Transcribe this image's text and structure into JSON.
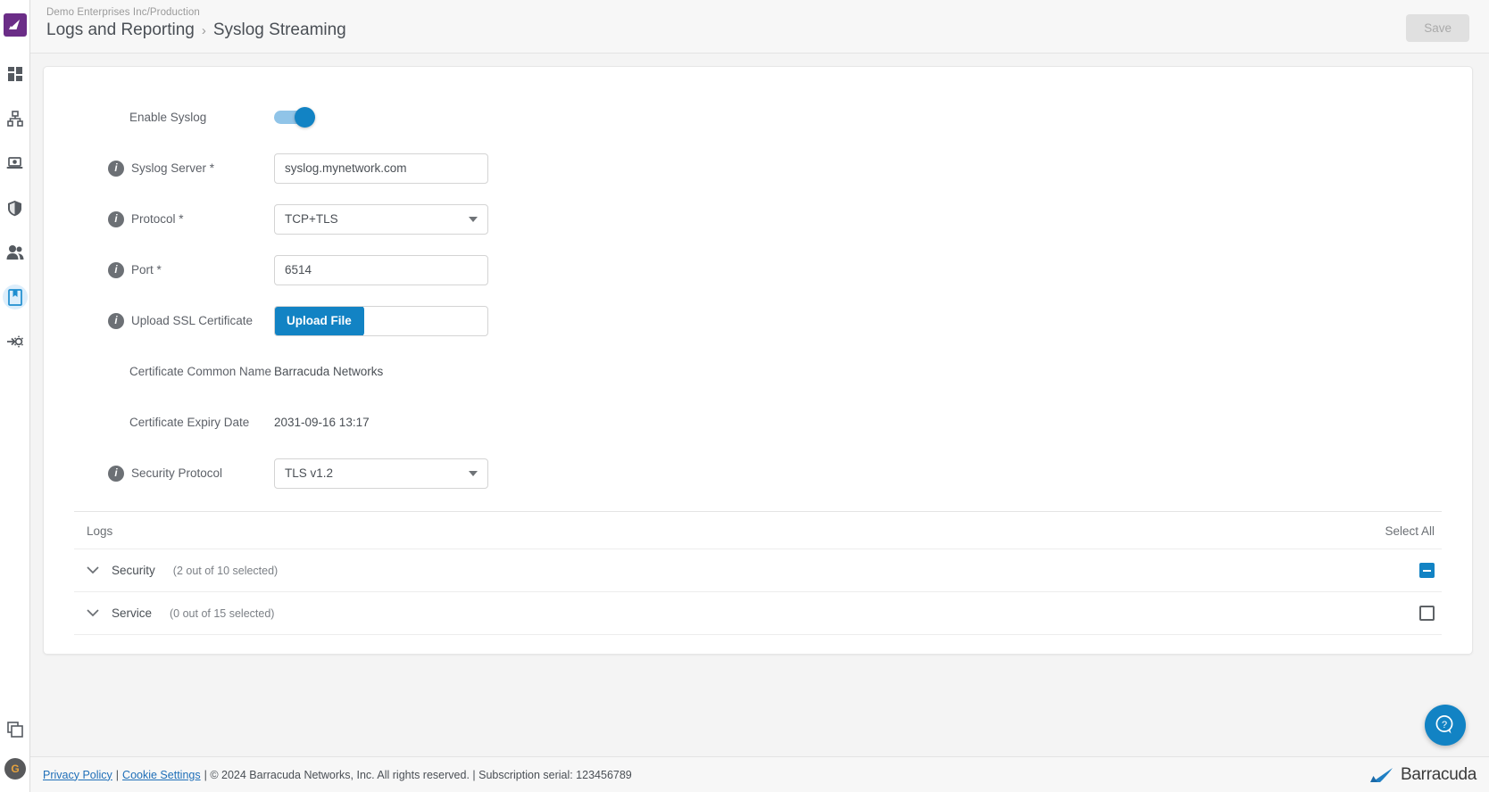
{
  "sidebar": {
    "logo_icon": "barracuda-fin-logo",
    "items": [
      {
        "icon": "dashboard-grid-icon",
        "name": "dashboard",
        "active": false
      },
      {
        "icon": "network-sitemap-icon",
        "name": "network",
        "active": false
      },
      {
        "icon": "endpoint-laptop-icon",
        "name": "endpoints",
        "active": false
      },
      {
        "icon": "shield-icon",
        "name": "security",
        "active": false
      },
      {
        "icon": "users-icon",
        "name": "users",
        "active": false
      },
      {
        "icon": "book-logs-icon",
        "name": "logs-and-reporting",
        "active": true
      },
      {
        "icon": "settings-gear-arrow-icon",
        "name": "advanced-settings",
        "active": false
      }
    ],
    "bottom": {
      "copy_icon": "copy-layers-icon",
      "avatar_initial": "G"
    }
  },
  "header": {
    "tenant": "Demo Enterprises Inc/Production",
    "breadcrumb_parent": "Logs and Reporting",
    "breadcrumb_separator": "›",
    "breadcrumb_current": "Syslog Streaming",
    "save_label": "Save",
    "save_disabled": true
  },
  "form": {
    "enable_syslog": {
      "label": "Enable Syslog",
      "value": true
    },
    "syslog_server": {
      "label": "Syslog Server *",
      "value": "syslog.mynetwork.com",
      "placeholder": "",
      "info_icon": "info-icon"
    },
    "protocol": {
      "label": "Protocol *",
      "value": "TCP+TLS",
      "info_icon": "info-icon"
    },
    "port": {
      "label": "Port *",
      "value": "6514",
      "placeholder": "",
      "info_icon": "info-icon"
    },
    "upload_ssl": {
      "label": "Upload SSL Certificate",
      "button_label": "Upload File",
      "filename": "",
      "info_icon": "info-icon"
    },
    "cert_common_name": {
      "label": "Certificate Common Name",
      "value": "Barracuda Networks"
    },
    "cert_expiry": {
      "label": "Certificate Expiry Date",
      "value": "2031-09-16 13:17"
    },
    "security_protocol": {
      "label": "Security Protocol",
      "value": "TLS v1.2",
      "info_icon": "info-icon"
    }
  },
  "logs": {
    "header_label": "Logs",
    "select_all_label": "Select All",
    "rows": [
      {
        "name": "Security",
        "count": "(2 out of 10 selected)",
        "state": "indeterminate"
      },
      {
        "name": "Service",
        "count": "(0 out of 15 selected)",
        "state": "unchecked"
      }
    ]
  },
  "help": {
    "icon": "help-question-bubble-icon"
  },
  "footer": {
    "privacy_policy": "Privacy Policy",
    "sep1": "|",
    "cookie_settings": "Cookie Settings",
    "copyright": "| © 2024 Barracuda Networks, Inc. All rights reserved. | Subscription serial: 123456789",
    "brand_name": "Barracuda",
    "brand_icon": "barracuda-fin-logo"
  },
  "colors": {
    "accent_blue": "#1283c4",
    "logo_purple": "#6b2d87",
    "page_bg": "#f4f4f4",
    "link_blue": "#1f6fb8"
  }
}
